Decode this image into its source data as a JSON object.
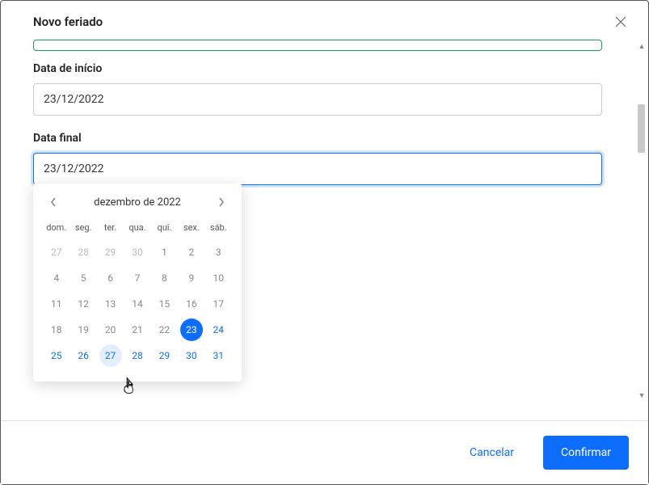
{
  "modal": {
    "title": "Novo feriado",
    "labels": {
      "start_date": "Data de início",
      "end_date": "Data final"
    },
    "values": {
      "start_date": "23/12/2022",
      "end_date": "23/12/2022"
    },
    "buttons": {
      "cancel": "Cancelar",
      "confirm": "Confirmar"
    }
  },
  "datepicker": {
    "month_label": "dezembro de 2022",
    "dow": [
      "dom.",
      "seg.",
      "ter.",
      "qua.",
      "qui.",
      "sex.",
      "sáb."
    ],
    "weeks": [
      [
        {
          "d": "27",
          "cls": "muted"
        },
        {
          "d": "28",
          "cls": "muted"
        },
        {
          "d": "29",
          "cls": "muted"
        },
        {
          "d": "30",
          "cls": "muted"
        },
        {
          "d": "1",
          "cls": "normal"
        },
        {
          "d": "2",
          "cls": "normal"
        },
        {
          "d": "3",
          "cls": "normal"
        }
      ],
      [
        {
          "d": "4",
          "cls": "normal"
        },
        {
          "d": "5",
          "cls": "normal"
        },
        {
          "d": "6",
          "cls": "normal"
        },
        {
          "d": "7",
          "cls": "normal"
        },
        {
          "d": "8",
          "cls": "normal"
        },
        {
          "d": "9",
          "cls": "normal"
        },
        {
          "d": "10",
          "cls": "normal"
        }
      ],
      [
        {
          "d": "11",
          "cls": "normal"
        },
        {
          "d": "12",
          "cls": "normal"
        },
        {
          "d": "13",
          "cls": "normal"
        },
        {
          "d": "14",
          "cls": "normal"
        },
        {
          "d": "15",
          "cls": "normal"
        },
        {
          "d": "16",
          "cls": "normal"
        },
        {
          "d": "17",
          "cls": "normal"
        }
      ],
      [
        {
          "d": "18",
          "cls": "normal"
        },
        {
          "d": "19",
          "cls": "normal"
        },
        {
          "d": "20",
          "cls": "normal"
        },
        {
          "d": "21",
          "cls": "normal"
        },
        {
          "d": "22",
          "cls": "normal"
        },
        {
          "d": "23",
          "cls": "selected"
        },
        {
          "d": "24",
          "cls": "current"
        }
      ],
      [
        {
          "d": "25",
          "cls": "current"
        },
        {
          "d": "26",
          "cls": "current"
        },
        {
          "d": "27",
          "cls": "hover"
        },
        {
          "d": "28",
          "cls": "current"
        },
        {
          "d": "29",
          "cls": "current"
        },
        {
          "d": "30",
          "cls": "current"
        },
        {
          "d": "31",
          "cls": "current"
        }
      ]
    ]
  }
}
